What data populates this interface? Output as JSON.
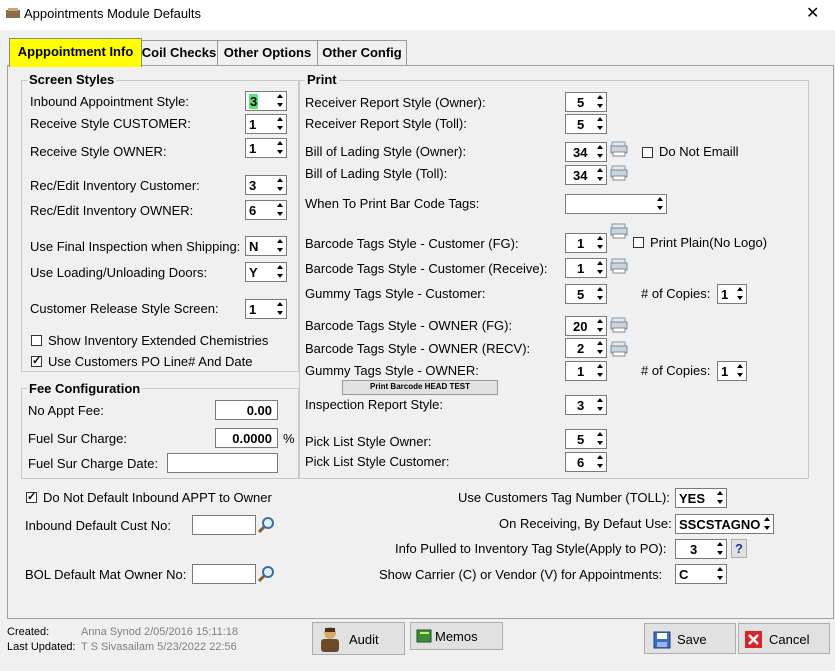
{
  "window": {
    "title": "Appointments Module Defaults",
    "close": "✕"
  },
  "tabs": [
    "Apppointment Info",
    "Coil Checks",
    "Other Options",
    "Other Config"
  ],
  "screen_styles": {
    "title": "Screen Styles",
    "inbound_appt_style": {
      "label": "Inbound Appointment Style:",
      "value": "3"
    },
    "receive_style_customer": {
      "label": "Receive Style CUSTOMER:",
      "value": "1"
    },
    "receive_style_owner": {
      "label": "Receive Style OWNER:",
      "value": "1"
    },
    "rec_edit_inv_customer": {
      "label": "Rec/Edit Inventory Customer:",
      "value": "3"
    },
    "rec_edit_inv_owner": {
      "label": "Rec/Edit Inventory OWNER:",
      "value": "6"
    },
    "final_inspection": {
      "label": "Use Final Inspection when Shipping:",
      "value": "N"
    },
    "loading_doors": {
      "label": "Use Loading/Unloading Doors:",
      "value": "Y"
    },
    "cust_release_style": {
      "label": "Customer Release Style Screen:",
      "value": "1"
    },
    "show_inv_ext_chem": {
      "label": "Show Inventory Extended Chemistries",
      "checked": false
    },
    "use_cust_po_line": {
      "label": "Use Customers PO Line#  And Date",
      "checked": true
    }
  },
  "fee_config": {
    "title": "Fee Configuration",
    "no_appt_fee": {
      "label": "No Appt Fee:",
      "value": "0.00"
    },
    "fuel_sur_charge": {
      "label": "Fuel Sur Charge:",
      "value": "0.0000",
      "unit": "%"
    },
    "fuel_sur_charge_date": {
      "label": "Fuel Sur Charge Date:",
      "value": ""
    }
  },
  "print": {
    "title": "Print",
    "receiver_owner": {
      "label": "Receiver Report Style (Owner):",
      "value": "5"
    },
    "receiver_toll": {
      "label": "Receiver Report Style (Toll):",
      "value": "5"
    },
    "bol_owner": {
      "label": "Bill of Lading Style (Owner):",
      "value": "34"
    },
    "bol_toll": {
      "label": "Bill of Lading Style (Toll):",
      "value": "34"
    },
    "do_not_email": {
      "label": "Do Not Emaill",
      "checked": false
    },
    "when_print_barcode": {
      "label": "When To Print Bar Code Tags:",
      "value": ""
    },
    "barcode_cust_fg": {
      "label": "Barcode Tags Style - Customer (FG):",
      "value": "1"
    },
    "print_plain": {
      "label": "Print Plain(No Logo)",
      "checked": false
    },
    "barcode_cust_receive": {
      "label": "Barcode Tags Style - Customer (Receive):",
      "value": "1"
    },
    "gummy_cust": {
      "label": "Gummy Tags Style - Customer:",
      "value": "5"
    },
    "copies_cust": {
      "label": "# of Copies:",
      "value": "1"
    },
    "barcode_owner_fg": {
      "label": "Barcode Tags Style - OWNER (FG):",
      "value": "20"
    },
    "barcode_owner_recv": {
      "label": "Barcode Tags Style - OWNER (RECV):",
      "value": "2"
    },
    "gummy_owner": {
      "label": "Gummy Tags Style - OWNER:",
      "value": "1"
    },
    "copies_owner": {
      "label": "# of Copies:",
      "value": "1"
    },
    "print_barcode_head_test": "Print Barcode HEAD TEST",
    "inspection_report": {
      "label": "Inspection Report Style:",
      "value": "3"
    },
    "pick_list_owner": {
      "label": "Pick List Style Owner:",
      "value": "5"
    },
    "pick_list_customer": {
      "label": "Pick List Style Customer:",
      "value": "6"
    }
  },
  "bottom": {
    "do_not_default_inbound": {
      "label": "Do Not Default Inbound APPT to Owner",
      "checked": true
    },
    "inbound_default_cust": {
      "label": "Inbound Default Cust No:",
      "value": ""
    },
    "bol_default_owner": {
      "label": "BOL Default Mat Owner No:",
      "value": ""
    },
    "use_cust_tag_number": {
      "label": "Use Customers Tag Number (TOLL):",
      "value": "YES"
    },
    "on_receiving_default": {
      "label": "On Receiving, By Defaut Use:",
      "value": "SSCSTAGNO"
    },
    "info_pulled": {
      "label": "Info Pulled to Inventory Tag Style(Apply to PO):",
      "value": "3",
      "help": "?"
    },
    "show_carrier": {
      "label": "Show Carrier (C) or Vendor (V) for Appointments:",
      "value": "C"
    }
  },
  "footer": {
    "created_label": "Created:",
    "created_value": "Anna Synod 2/05/2016 15:11:18",
    "updated_label": "Last Updated:",
    "updated_value": "T S Sivasailam 5/23/2022 22:56",
    "audit": "Audit",
    "memos": "Memos",
    "save": "Save",
    "cancel": "Cancel"
  }
}
